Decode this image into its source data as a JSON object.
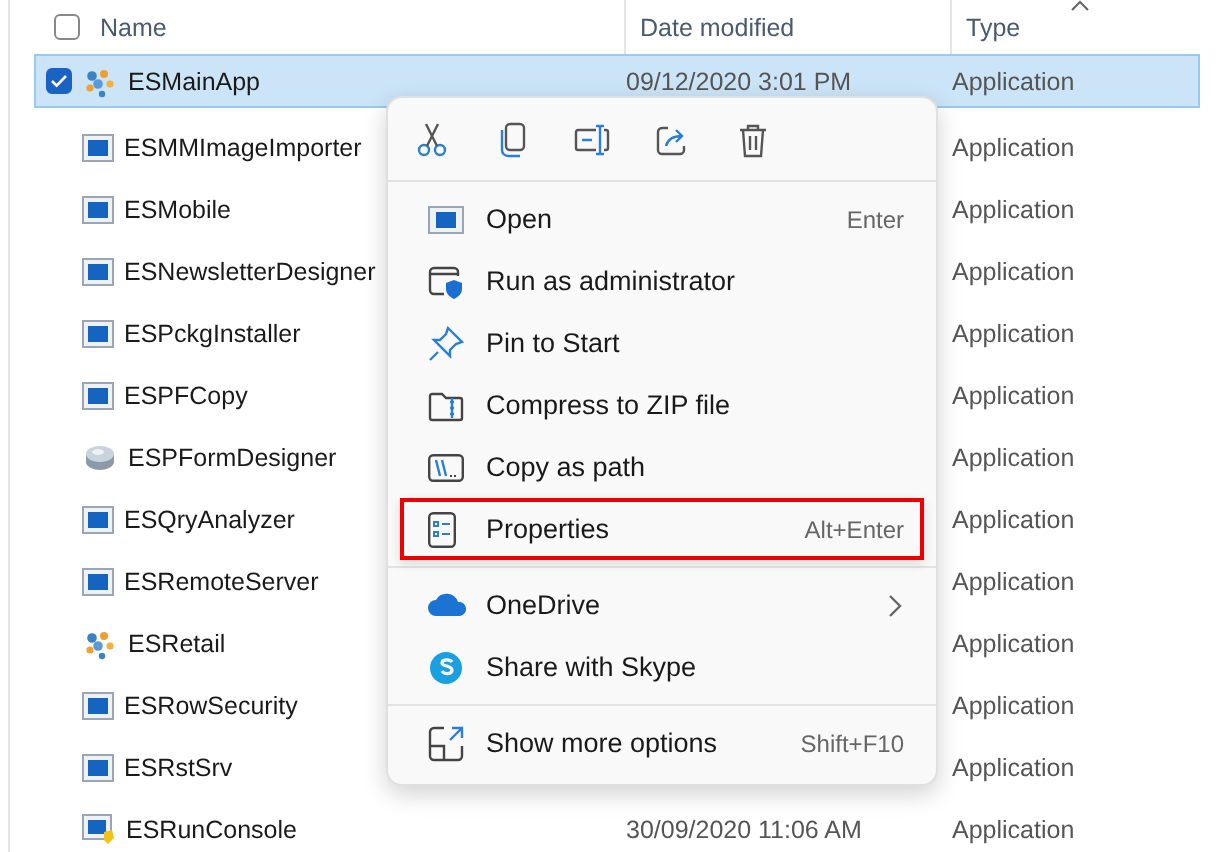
{
  "header": {
    "checked": false,
    "columns": [
      "Name",
      "Date modified",
      "Type"
    ]
  },
  "rows": [
    {
      "kind": "cluster",
      "name": "ESMainApp",
      "date": "09/12/2020 3:01 PM",
      "type": "Application",
      "selected": true
    },
    {
      "kind": "window",
      "name": "ESMMImageImporter",
      "type": "Application",
      "selected": false
    },
    {
      "kind": "window",
      "name": "ESMobile",
      "type": "Application",
      "selected": false
    },
    {
      "kind": "window",
      "name": "ESNewsletterDesigner",
      "type": "Application",
      "selected": false
    },
    {
      "kind": "window",
      "name": "ESPckgInstaller",
      "type": "Application",
      "selected": false
    },
    {
      "kind": "window",
      "name": "ESPFCopy",
      "type": "Application",
      "selected": false
    },
    {
      "kind": "drive",
      "name": "ESPFormDesigner",
      "type": "Application",
      "selected": false
    },
    {
      "kind": "window",
      "name": "ESQryAnalyzer",
      "type": "Application",
      "selected": false
    },
    {
      "kind": "window",
      "name": "ESRemoteServer",
      "type": "Application",
      "selected": false
    },
    {
      "kind": "cluster",
      "name": "ESRetail",
      "type": "Application",
      "selected": false
    },
    {
      "kind": "window",
      "name": "ESRowSecurity",
      "type": "Application",
      "selected": false
    },
    {
      "kind": "window",
      "name": "ESRstSrv",
      "type": "Application",
      "selected": false
    },
    {
      "kind": "console",
      "name": "ESRunConsole",
      "date": "30/09/2020 11:06 AM",
      "type": "Application",
      "selected": false
    }
  ],
  "context_menu": {
    "toolbar": [
      {
        "kind": "cut"
      },
      {
        "kind": "copy"
      },
      {
        "kind": "rename"
      },
      {
        "kind": "share"
      },
      {
        "kind": "delete"
      }
    ],
    "groups": [
      [
        {
          "kind": "open",
          "label": "Open",
          "shortcut": "Enter",
          "highlighted": false
        },
        {
          "kind": "admin",
          "label": "Run as administrator",
          "highlighted": false
        },
        {
          "kind": "pin",
          "label": "Pin to Start",
          "highlighted": false
        },
        {
          "kind": "zip",
          "label": "Compress to ZIP file",
          "highlighted": false
        },
        {
          "kind": "path",
          "label": "Copy as path",
          "highlighted": false
        },
        {
          "kind": "properties",
          "label": "Properties",
          "shortcut": "Alt+Enter",
          "highlighted": true
        }
      ],
      [
        {
          "kind": "onedrive",
          "label": "OneDrive",
          "submenu": true,
          "highlighted": false
        },
        {
          "kind": "skype",
          "label": "Share with Skype",
          "highlighted": false
        }
      ],
      [
        {
          "kind": "more",
          "label": "Show more options",
          "shortcut": "Shift+F10",
          "highlighted": false
        }
      ]
    ]
  }
}
